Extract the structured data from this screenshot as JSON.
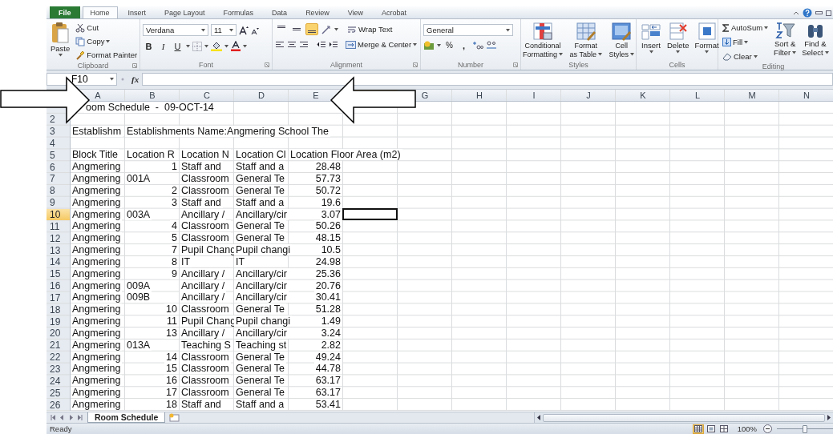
{
  "ribbon": {
    "tabs": [
      {
        "label": "File",
        "kind": "file",
        "selected": false
      },
      {
        "label": "Home",
        "kind": "tab",
        "selected": true
      },
      {
        "label": "Insert",
        "kind": "tab",
        "selected": false
      },
      {
        "label": "Page Layout",
        "kind": "tab",
        "selected": false
      },
      {
        "label": "Formulas",
        "kind": "tab",
        "selected": false
      },
      {
        "label": "Data",
        "kind": "tab",
        "selected": false
      },
      {
        "label": "Review",
        "kind": "tab",
        "selected": false
      },
      {
        "label": "View",
        "kind": "tab",
        "selected": false
      },
      {
        "label": "Acrobat",
        "kind": "tab",
        "selected": false
      }
    ],
    "clipboard": {
      "label": "Clipboard",
      "paste": "Paste",
      "cut": "Cut",
      "copy": "Copy",
      "format_painter": "Format Painter"
    },
    "font": {
      "label": "Font",
      "name": "Verdana",
      "size": "11",
      "bold": "B",
      "italic": "I",
      "underline": "U"
    },
    "alignment": {
      "label": "Alignment",
      "vertical": [
        {
          "kind": "top",
          "selected": false
        },
        {
          "kind": "middle",
          "selected": false
        },
        {
          "kind": "bottom",
          "selected": true
        }
      ],
      "wrap_text": "Wrap Text",
      "merge": "Merge & Center"
    },
    "number": {
      "label": "Number",
      "format": "General",
      "percent": "%",
      "comma": ","
    },
    "styles": {
      "label": "Styles",
      "buttons": [
        {
          "kind": "conditional",
          "lines": [
            "Conditional",
            "Formatting"
          ]
        },
        {
          "kind": "table",
          "lines": [
            "Format",
            "as Table"
          ]
        },
        {
          "kind": "cell",
          "lines": [
            "Cell",
            "Styles"
          ]
        }
      ]
    },
    "cells": {
      "label": "Cells",
      "buttons": [
        {
          "kind": "insert",
          "label": "Insert"
        },
        {
          "kind": "delete",
          "label": "Delete"
        },
        {
          "kind": "format",
          "label": "Format"
        }
      ]
    },
    "editing": {
      "label": "Editing",
      "autosum": "AutoSum",
      "fill": "Fill",
      "clear": "Clear",
      "sort": [
        "Sort &",
        "Filter"
      ],
      "find": [
        "Find &",
        "Select"
      ]
    }
  },
  "formula_bar": {
    "name_box": "F10",
    "function_label": "fx"
  },
  "sheet": {
    "columns": [
      {
        "label": "A",
        "selected": false
      },
      {
        "label": "B",
        "selected": false
      },
      {
        "label": "C",
        "selected": false
      },
      {
        "label": "D",
        "selected": false
      },
      {
        "label": "E",
        "selected": false
      },
      {
        "selected": true
      },
      {
        "label": "G",
        "selected": false
      },
      {
        "label": "H",
        "selected": false
      },
      {
        "label": "I",
        "selected": false
      },
      {
        "label": "J",
        "selected": false
      },
      {
        "label": "K",
        "selected": false
      },
      {
        "label": "L",
        "selected": false
      },
      {
        "label": "M",
        "selected": false
      },
      {
        "label": "N",
        "selected": false
      }
    ],
    "rows": [
      {
        "selected": false,
        "cells": [
          "oom Schedule  -  09-OCT-14"
        ]
      },
      {
        "number": "2",
        "selected": false
      },
      {
        "number": "3",
        "selected": false,
        "cells": [
          "Establishm",
          "Establishments Name:Angmering School The"
        ]
      },
      {
        "number": "4",
        "selected": false
      },
      {
        "number": "5",
        "selected": false,
        "cells": [
          "Block Title",
          "Location R",
          "Location N",
          "Location Cl",
          "Location Floor Area (m2)"
        ]
      },
      {
        "number": "6",
        "selected": false,
        "cells": [
          "Angmering",
          {
            "text": "1",
            "kind": "number"
          },
          "Staff and",
          "Staff and a",
          {
            "text": "28.48",
            "kind": "number"
          }
        ]
      },
      {
        "number": "7",
        "selected": false,
        "cells": [
          "Angmering",
          "001A",
          "Classroom",
          "General Te",
          {
            "text": "57.73",
            "kind": "number"
          }
        ]
      },
      {
        "number": "8",
        "selected": false,
        "cells": [
          "Angmering",
          {
            "text": "2",
            "kind": "number"
          },
          "Classroom",
          "General Te",
          {
            "text": "50.72",
            "kind": "number"
          }
        ]
      },
      {
        "number": "9",
        "selected": false,
        "cells": [
          "Angmering",
          {
            "text": "3",
            "kind": "number"
          },
          "Staff and",
          "Staff and a",
          {
            "text": "19.6",
            "kind": "number"
          }
        ]
      },
      {
        "number": "10",
        "selected": true,
        "cells": [
          "Angmering",
          "003A",
          "Ancillary /",
          "Ancillary/cir",
          {
            "text": "3.07",
            "kind": "number"
          }
        ]
      },
      {
        "number": "11",
        "selected": false,
        "cells": [
          "Angmering",
          {
            "text": "4",
            "kind": "number"
          },
          "Classroom",
          "General Te",
          {
            "text": "50.26",
            "kind": "number"
          }
        ]
      },
      {
        "number": "12",
        "selected": false,
        "cells": [
          "Angmering",
          {
            "text": "5",
            "kind": "number"
          },
          "Classroom",
          "General Te",
          {
            "text": "48.15",
            "kind": "number"
          }
        ]
      },
      {
        "number": "13",
        "selected": false,
        "cells": [
          "Angmering",
          {
            "text": "7",
            "kind": "number"
          },
          "Pupil Chang",
          "Pupil changi",
          {
            "text": "10.5",
            "kind": "number"
          }
        ]
      },
      {
        "number": "14",
        "selected": false,
        "cells": [
          "Angmering",
          {
            "text": "8",
            "kind": "number"
          },
          "IT",
          "IT",
          {
            "text": "24.98",
            "kind": "number"
          }
        ]
      },
      {
        "number": "15",
        "selected": false,
        "cells": [
          "Angmering",
          {
            "text": "9",
            "kind": "number"
          },
          "Ancillary /",
          "Ancillary/cir",
          {
            "text": "25.36",
            "kind": "number"
          }
        ]
      },
      {
        "number": "16",
        "selected": false,
        "cells": [
          "Angmering",
          "009A",
          "Ancillary /",
          "Ancillary/cir",
          {
            "text": "20.76",
            "kind": "number"
          }
        ]
      },
      {
        "number": "17",
        "selected": false,
        "cells": [
          "Angmering",
          "009B",
          "Ancillary /",
          "Ancillary/cir",
          {
            "text": "30.41",
            "kind": "number"
          }
        ]
      },
      {
        "number": "18",
        "selected": false,
        "cells": [
          "Angmering",
          {
            "text": "10",
            "kind": "number"
          },
          "Classroom",
          "General Te",
          {
            "text": "51.28",
            "kind": "number"
          }
        ]
      },
      {
        "number": "19",
        "selected": false,
        "cells": [
          "Angmering",
          {
            "text": "11",
            "kind": "number"
          },
          "Pupil Chang",
          "Pupil changi",
          {
            "text": "1.49",
            "kind": "number"
          }
        ]
      },
      {
        "number": "20",
        "selected": false,
        "cells": [
          "Angmering",
          {
            "text": "13",
            "kind": "number"
          },
          "Ancillary /",
          "Ancillary/cir",
          {
            "text": "3.24",
            "kind": "number"
          }
        ]
      },
      {
        "number": "21",
        "selected": false,
        "cells": [
          "Angmering",
          "013A",
          "Teaching S",
          "Teaching st",
          {
            "text": "2.82",
            "kind": "number"
          }
        ]
      },
      {
        "number": "22",
        "selected": false,
        "cells": [
          "Angmering",
          {
            "text": "14",
            "kind": "number"
          },
          "Classroom",
          "General Te",
          {
            "text": "49.24",
            "kind": "number"
          }
        ]
      },
      {
        "number": "23",
        "selected": false,
        "cells": [
          "Angmering",
          {
            "text": "15",
            "kind": "number"
          },
          "Classroom",
          "General Te",
          {
            "text": "44.78",
            "kind": "number"
          }
        ]
      },
      {
        "number": "24",
        "selected": false,
        "cells": [
          "Angmering",
          {
            "text": "16",
            "kind": "number"
          },
          "Classroom",
          "General Te",
          {
            "text": "63.17",
            "kind": "number"
          }
        ]
      },
      {
        "number": "25",
        "selected": false,
        "cells": [
          "Angmering",
          {
            "text": "17",
            "kind": "number"
          },
          "Classroom",
          "General Te",
          {
            "text": "63.17",
            "kind": "number"
          }
        ]
      },
      {
        "number": "26",
        "selected": false,
        "cells": [
          "Angmering",
          {
            "text": "18",
            "kind": "number"
          },
          "Staff and",
          "Staff and a",
          {
            "text": "53.41",
            "kind": "number"
          }
        ]
      }
    ]
  },
  "sheet_tabs": {
    "tabs": [
      {
        "label": "Room Schedule",
        "selected": true
      }
    ]
  },
  "status_bar": {
    "text": "Ready",
    "views": [
      {
        "kind": "normal",
        "selected": true
      },
      {
        "kind": "page_layout",
        "selected": false
      },
      {
        "kind": "page_break",
        "selected": false
      }
    ],
    "zoom": "100%",
    "zoom_slider": {
      "level": 0.5
    }
  }
}
